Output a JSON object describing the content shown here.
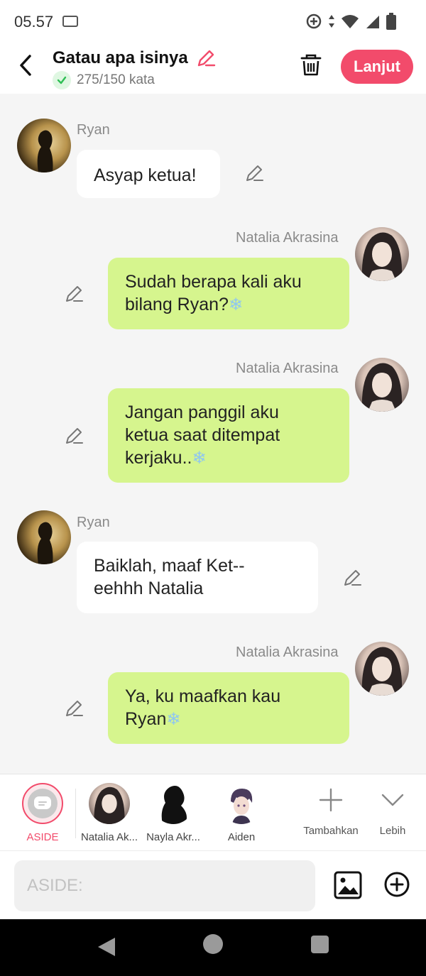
{
  "status_bar": {
    "time": "05.57"
  },
  "header": {
    "title": "Gatau apa isinya",
    "word_count": "275/150 kata",
    "continue_label": "Lanjut",
    "accent_color": "#f24b6b"
  },
  "messages": [
    {
      "sender": "Ryan",
      "side": "left",
      "text": "Asyap ketua!"
    },
    {
      "sender": "Natalia Akrasina",
      "side": "right",
      "text_lines": [
        "Sudah berapa kali aku",
        "bilang Ryan?"
      ],
      "emoji": "❄"
    },
    {
      "sender": "Natalia Akrasina",
      "side": "right",
      "text_lines": [
        "Jangan panggil aku",
        "ketua saat ditempat",
        "kerjaku.."
      ],
      "emoji": "❄"
    },
    {
      "sender": "Ryan",
      "side": "left",
      "text_lines": [
        "Baiklah, maaf Ket--",
        "eehhh Natalia"
      ]
    },
    {
      "sender": "Natalia Akrasina",
      "side": "right",
      "text_lines": [
        "Ya, ku maafkan kau",
        "Ryan"
      ],
      "emoji": "❄"
    }
  ],
  "characters": [
    {
      "label": "ASIDE",
      "selected": true
    },
    {
      "label": "Natalia Ak..."
    },
    {
      "label": "Nayla Akr..."
    },
    {
      "label": "Aiden"
    }
  ],
  "actions": {
    "add_label": "Tambahkan",
    "more_label": "Lebih"
  },
  "input": {
    "placeholder": "ASIDE:"
  },
  "colors": {
    "right_bubble": "#d6f58e",
    "left_bubble": "#ffffff",
    "background": "#f5f5f5"
  }
}
